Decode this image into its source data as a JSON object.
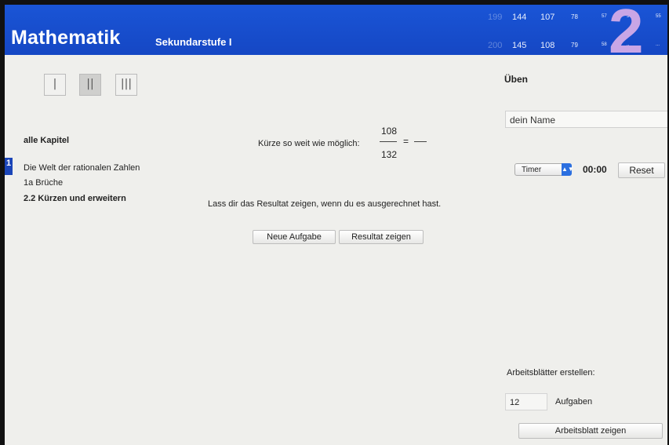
{
  "header": {
    "title": "Mathematik",
    "subtitle": "Sekundarstufe I",
    "top_row": [
      "199",
      "144",
      "107",
      "78",
      "57",
      "56",
      "55"
    ],
    "bottom_row": [
      "200",
      "145",
      "108",
      "79",
      "58",
      "..",
      "..."
    ],
    "big_digit": "2"
  },
  "levels": [
    {
      "label": "|",
      "selected": false
    },
    {
      "label": "||",
      "selected": true
    },
    {
      "label": "|||",
      "selected": false
    }
  ],
  "sidebar": {
    "all_chapters": "alle Kapitel",
    "chapter_number": "1",
    "chapter_title": "Die Welt der rationalen Zahlen",
    "section": "1a Brüche",
    "subsection": "2.2 Kürzen und erweitern"
  },
  "exercise": {
    "prompt": "Kürze so weit wie möglich:",
    "numerator": "108",
    "denominator": "132",
    "equals": "=",
    "instruction": "Lass dir das Resultat zeigen, wenn du es ausgerechnet hast.",
    "new_task": "Neue Aufgabe",
    "show_result": "Resultat zeigen"
  },
  "practice": {
    "title": "Üben",
    "name_value": "dein Name",
    "timer_select": "Timer",
    "time": "00:00",
    "reset": "Reset"
  },
  "worksheet": {
    "title": "Arbeitsblätter erstellen:",
    "count": "12",
    "count_label": "Aufgaben",
    "show_button": "Arbeitsblatt zeigen"
  },
  "colors": {
    "header_blue": "#1a55d6",
    "chapter_blue": "#1b45b8",
    "select_blue": "#2b6fe0"
  }
}
